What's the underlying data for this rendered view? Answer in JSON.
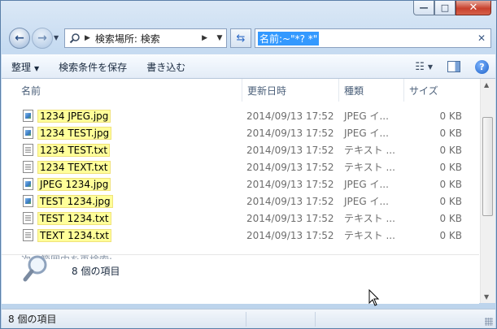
{
  "window": {
    "minimize": "—",
    "maximize": "□",
    "close": "✕"
  },
  "address": {
    "path": "検索場所: 検索"
  },
  "search": {
    "value": "名前:~\"*? *\""
  },
  "toolbar": {
    "organize": "整理",
    "save_search": "検索条件を保存",
    "burn": "書き込む"
  },
  "columns": {
    "name": "名前",
    "date": "更新日時",
    "type": "種類",
    "size": "サイズ"
  },
  "files": [
    {
      "name": "1234 JPEG.jpg",
      "date": "2014/09/13 17:52",
      "type": "JPEG イ...",
      "size": "0 KB",
      "icon": "image-file-icon"
    },
    {
      "name": "1234 TEST.jpg",
      "date": "2014/09/13 17:52",
      "type": "JPEG イ...",
      "size": "0 KB",
      "icon": "image-file-icon"
    },
    {
      "name": "1234 TEST.txt",
      "date": "2014/09/13 17:52",
      "type": "テキスト ...",
      "size": "0 KB",
      "icon": "text-file-icon"
    },
    {
      "name": "1234 TEXT.txt",
      "date": "2014/09/13 17:52",
      "type": "テキスト ...",
      "size": "0 KB",
      "icon": "text-file-icon"
    },
    {
      "name": "JPEG 1234.jpg",
      "date": "2014/09/13 17:52",
      "type": "JPEG イ...",
      "size": "0 KB",
      "icon": "image-file-icon"
    },
    {
      "name": "TEST 1234.jpg",
      "date": "2014/09/13 17:52",
      "type": "JPEG イ...",
      "size": "0 KB",
      "icon": "image-file-icon"
    },
    {
      "name": "TEST 1234.txt",
      "date": "2014/09/13 17:52",
      "type": "テキスト ...",
      "size": "0 KB",
      "icon": "text-file-icon"
    },
    {
      "name": "TEXT 1234.txt",
      "date": "2014/09/13 17:52",
      "type": "テキスト ...",
      "size": "0 KB",
      "icon": "text-file-icon"
    }
  ],
  "search_again": "次の範囲内を再検索:",
  "details": {
    "count": "8 個の項目"
  },
  "status": {
    "count": "8 個の項目"
  }
}
